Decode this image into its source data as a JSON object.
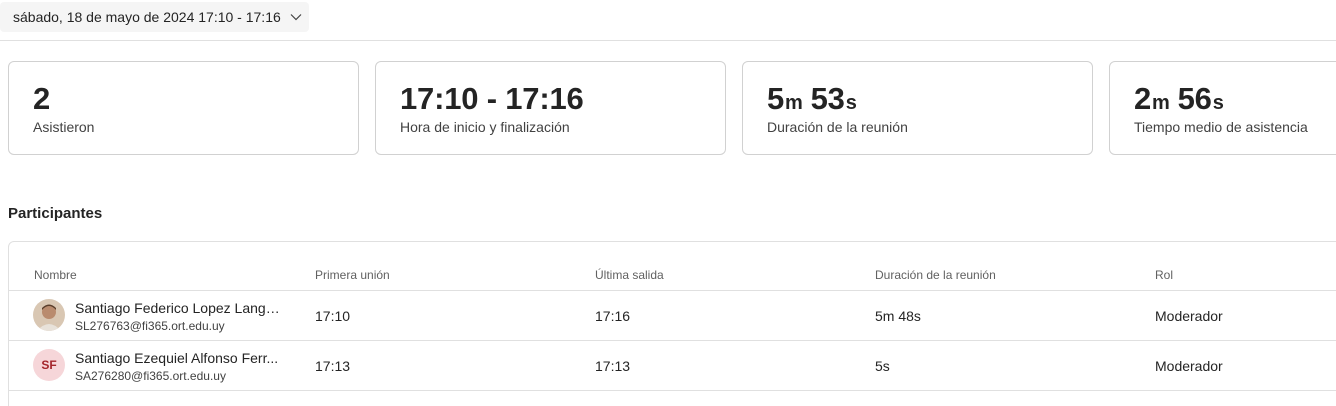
{
  "date_picker": {
    "label": "sábado, 18 de mayo de 2024 17:10 - 17:16",
    "icon": "chevron-down-icon"
  },
  "stats": {
    "attended": {
      "value": "2",
      "label": "Asistieron"
    },
    "start_end": {
      "value": "17:10 - 17:16",
      "label": "Hora de inicio y finalización"
    },
    "duration": {
      "min": "5",
      "min_unit": "m",
      "sec": "53",
      "sec_unit": "s",
      "label": "Duración de la reunión"
    },
    "avg_attendance": {
      "min": "2",
      "min_unit": "m",
      "sec": "56",
      "sec_unit": "s",
      "label": "Tiempo medio de asistencia"
    }
  },
  "participants": {
    "title": "Participantes",
    "columns": [
      "Nombre",
      "Primera unión",
      "Última salida",
      "Duración de la reunión",
      "Rol"
    ],
    "rows": [
      {
        "name": "Santiago Federico Lopez Lange...",
        "email": "SL276763@fi365.ort.edu.uy",
        "avatar": "photo",
        "first_join": "17:10",
        "last_leave": "17:16",
        "duration": "5m 48s",
        "role": "Moderador"
      },
      {
        "name": "Santiago Ezequiel Alfonso Ferr...",
        "email": "SA276280@fi365.ort.edu.uy",
        "avatar_initials": "SF",
        "first_join": "17:13",
        "last_leave": "17:13",
        "duration": "5s",
        "role": "Moderador"
      }
    ]
  }
}
